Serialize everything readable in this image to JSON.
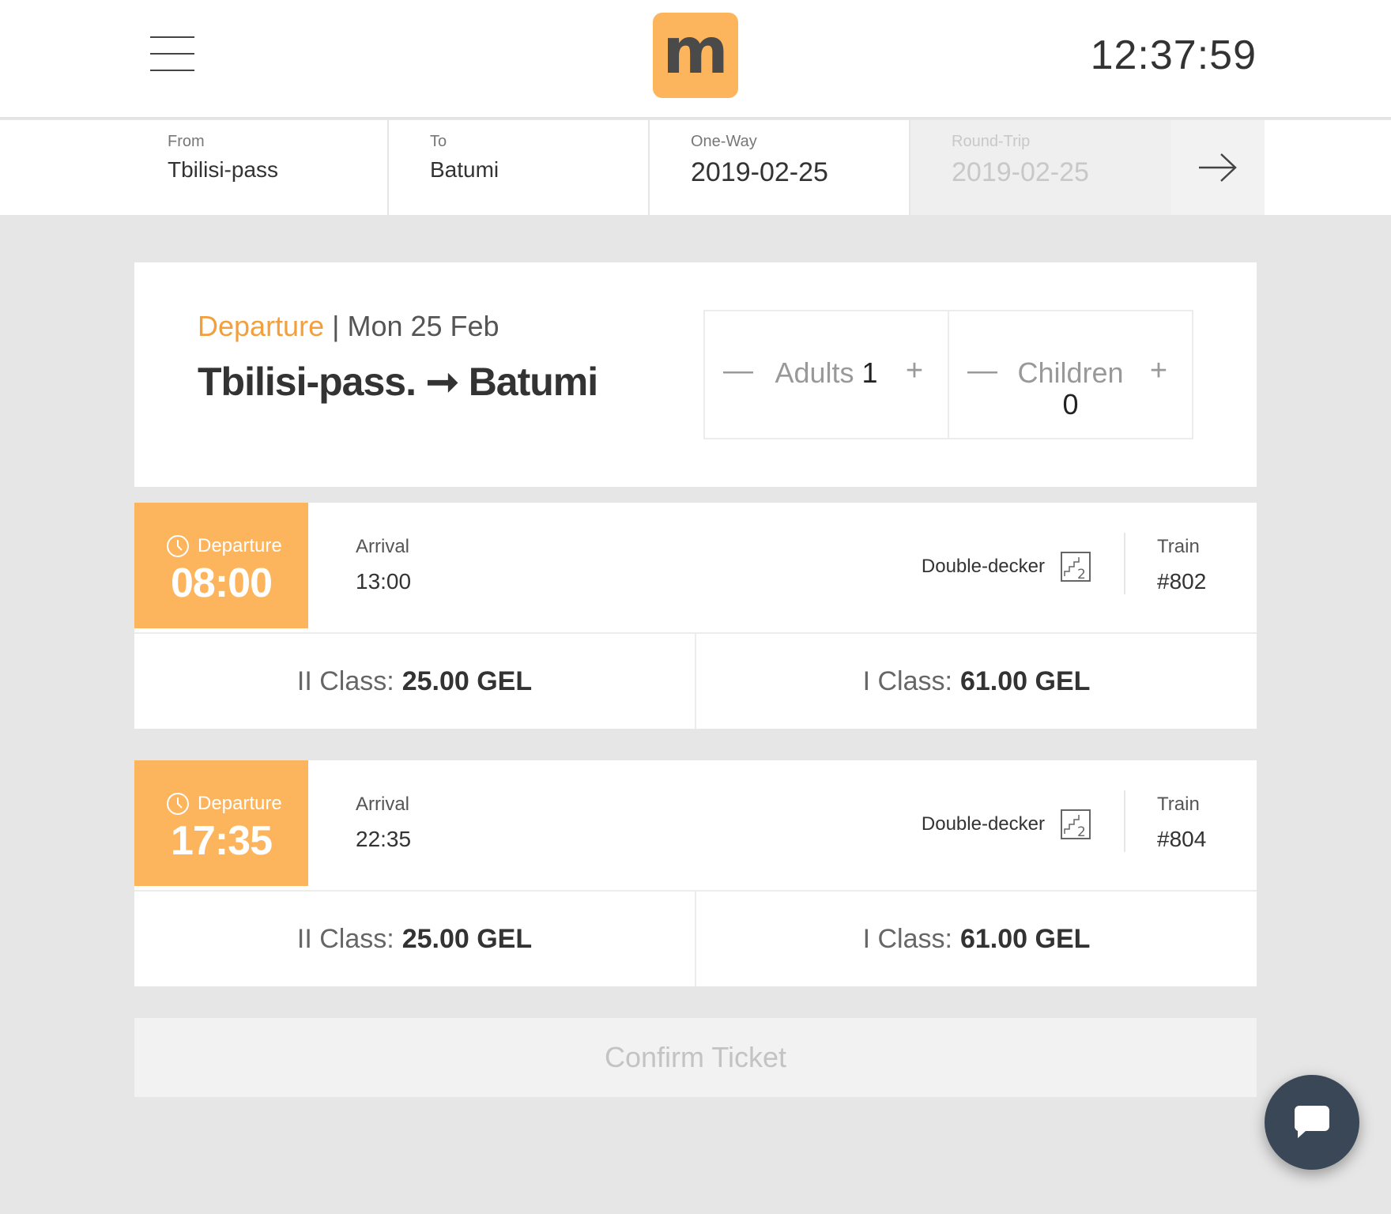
{
  "header": {
    "logo_text": "m",
    "time": "12:37:59"
  },
  "search": {
    "from_label": "From",
    "from_value": "Tbilisi-pass",
    "to_label": "To",
    "to_value": "Batumi",
    "oneway_label": "One-Way",
    "oneway_value": "2019-02-25",
    "round_label": "Round-Trip",
    "round_value": "2019-02-25"
  },
  "route": {
    "departure_label": "Departure",
    "separator": " | ",
    "date": "Mon 25 Feb",
    "origin": "Tbilisi-pass.",
    "arrow": "➞",
    "destination": "Batumi"
  },
  "passengers": {
    "adults_label": "Adults",
    "adults_value": "1",
    "children_label": "Children",
    "children_value": "0",
    "minus": "—",
    "plus": "+"
  },
  "trains": [
    {
      "departure_label": "Departure",
      "departure_time": "08:00",
      "arrival_label": "Arrival",
      "arrival_time": "13:00",
      "type": "Double-decker",
      "train_label": "Train",
      "train_number": "#802",
      "class2_label": "II Class:",
      "class2_price": "25.00 GEL",
      "class1_label": "I Class:",
      "class1_price": "61.00 GEL"
    },
    {
      "departure_label": "Departure",
      "departure_time": "17:35",
      "arrival_label": "Arrival",
      "arrival_time": "22:35",
      "type": "Double-decker",
      "train_label": "Train",
      "train_number": "#804",
      "class2_label": "II Class:",
      "class2_price": "25.00 GEL",
      "class1_label": "I Class:",
      "class1_price": "61.00 GEL"
    }
  ],
  "confirm_label": "Confirm Ticket",
  "icons": {
    "menu": "hamburger-icon",
    "next": "arrow-right-icon",
    "clock": "clock-icon",
    "double_decker": "double-decker-icon",
    "chat": "chat-icon"
  },
  "colors": {
    "accent": "#fdb55d",
    "accent_text": "#f3a03c",
    "chat_bg": "#3a4757"
  }
}
